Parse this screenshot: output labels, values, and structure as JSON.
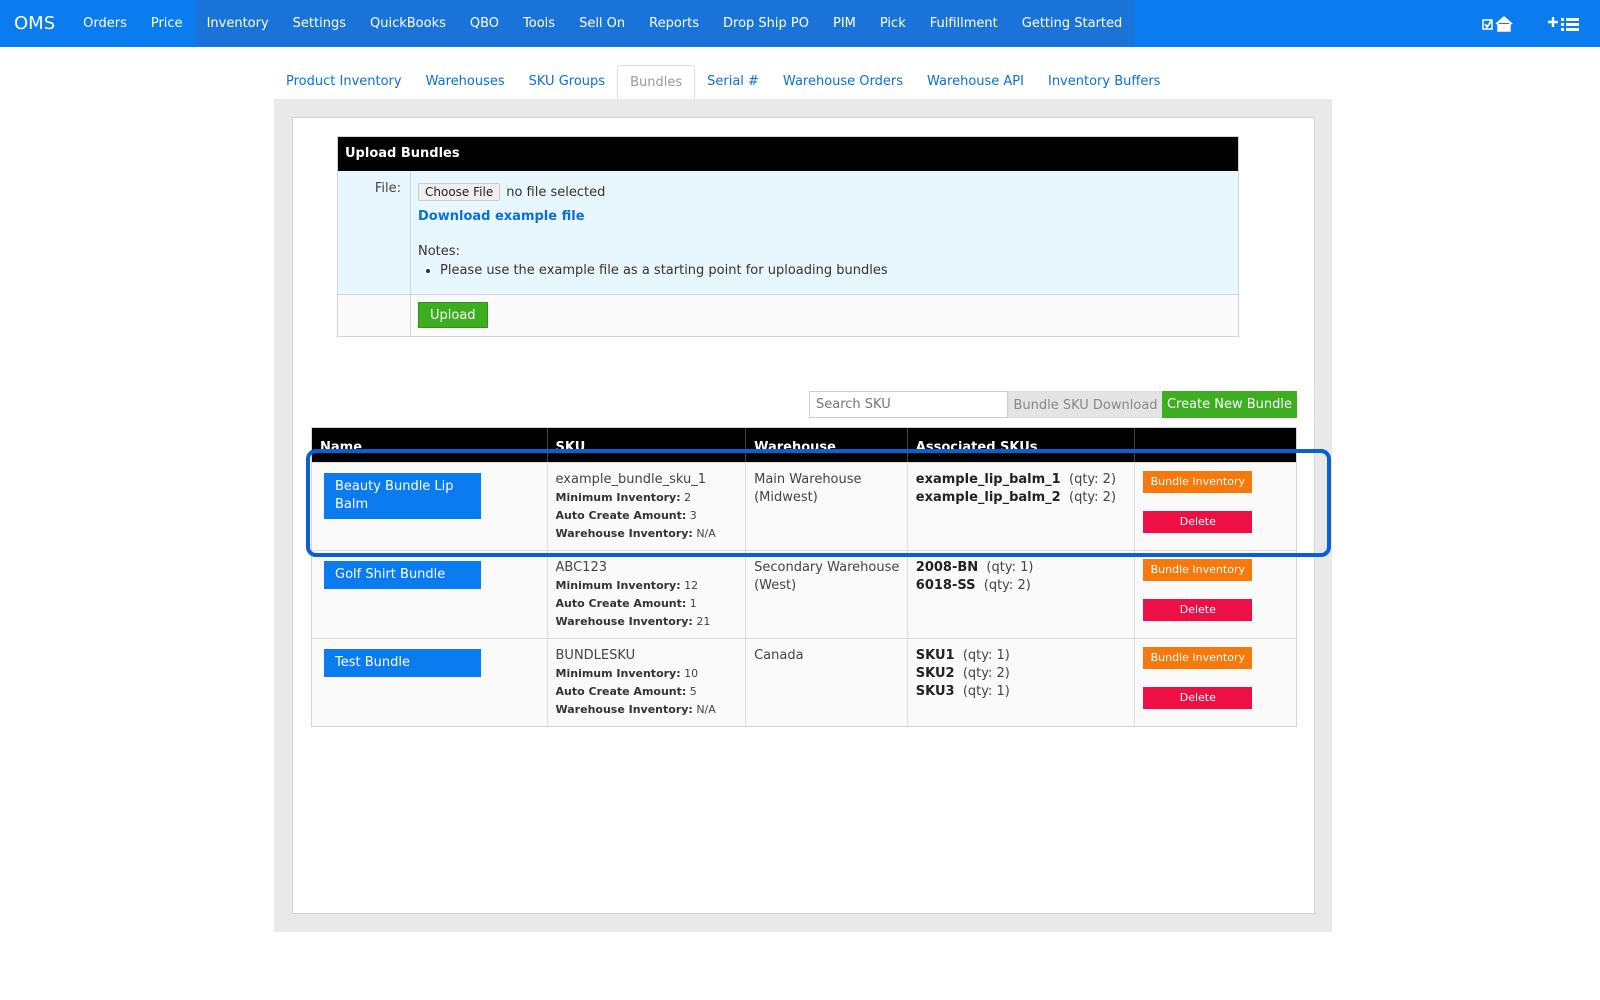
{
  "nav": {
    "brand": "OMS",
    "items": [
      "Orders",
      "Price",
      "Inventory",
      "Settings",
      "QuickBooks",
      "QBO",
      "Tools",
      "Sell On",
      "Reports",
      "Drop Ship PO",
      "PIM",
      "Pick",
      "Fulfillment",
      "Getting Started"
    ],
    "active": "Inventory"
  },
  "subtabs": {
    "items": [
      "Product Inventory",
      "Warehouses",
      "SKU Groups",
      "Bundles",
      "Serial #",
      "Warehouse Orders",
      "Warehouse API",
      "Inventory Buffers"
    ],
    "active": "Bundles"
  },
  "upload": {
    "title": "Upload Bundles",
    "file_label": "File:",
    "choose_file": "Choose File",
    "no_file": "no file selected",
    "download_link": "Download example file",
    "notes_label": "Notes:",
    "note_1": "Please use the example file as a starting point for uploading bundles",
    "upload_button": "Upload"
  },
  "toolbar": {
    "search_placeholder": "Search SKU",
    "download_button": "Bundle SKU Download",
    "create_button": "Create New Bundle"
  },
  "table": {
    "headers": [
      "Name",
      "SKU",
      "Warehouse",
      "Associated SKUs",
      ""
    ],
    "min_label": "Minimum Inventory:",
    "auto_label": "Auto Create Amount:",
    "wh_inv_label": "Warehouse Inventory:",
    "inventory_button": "Bundle Inventory",
    "delete_button": "Delete",
    "rows": [
      {
        "name": "Beauty Bundle Lip Balm",
        "sku": "example_bundle_sku_1",
        "min_inventory": "2",
        "auto_create": "3",
        "warehouse_inventory": "N/A",
        "warehouse": "Main Warehouse (Midwest)",
        "associated": [
          {
            "sku": "example_lip_balm_1",
            "qty": "(qty: 2)"
          },
          {
            "sku": "example_lip_balm_2",
            "qty": "(qty: 2)"
          }
        ]
      },
      {
        "name": "Golf Shirt Bundle",
        "sku": "ABC123",
        "min_inventory": "12",
        "auto_create": "1",
        "warehouse_inventory": "21",
        "warehouse": "Secondary Warehouse (West)",
        "associated": [
          {
            "sku": "2008-BN",
            "qty": "(qty: 1)"
          },
          {
            "sku": "6018-SS",
            "qty": "(qty: 2)"
          }
        ]
      },
      {
        "name": "Test Bundle",
        "sku": "BUNDLESKU",
        "min_inventory": "10",
        "auto_create": "5",
        "warehouse_inventory": "N/A",
        "warehouse": "Canada",
        "associated": [
          {
            "sku": "SKU1",
            "qty": "(qty: 1)"
          },
          {
            "sku": "SKU2",
            "qty": "(qty: 2)"
          },
          {
            "sku": "SKU3",
            "qty": "(qty: 1)"
          }
        ]
      }
    ]
  },
  "colors": {
    "nav_bg": "#0a7cf0",
    "green": "#3dae20",
    "orange": "#f7780b",
    "red": "#ee1044",
    "highlight": "#0a5fd5"
  }
}
